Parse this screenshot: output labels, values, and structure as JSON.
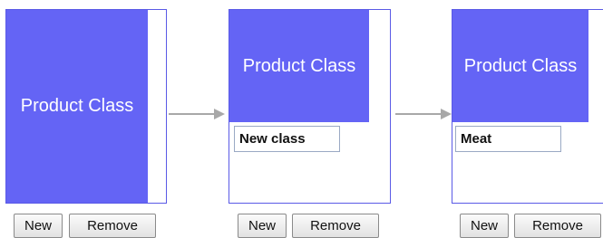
{
  "colors": {
    "accent": "#6464f5",
    "border": "#5a5ae6",
    "arrow": "#a8a8a8"
  },
  "panels": [
    {
      "heading": "Product Class",
      "new_label": "New",
      "remove_label": "Remove"
    },
    {
      "heading": "Product Class",
      "input_value": "New class",
      "new_label": "New",
      "remove_label": "Remove"
    },
    {
      "heading": "Product Class",
      "input_value": "Meat",
      "new_label": "New",
      "remove_label": "Remove"
    }
  ]
}
